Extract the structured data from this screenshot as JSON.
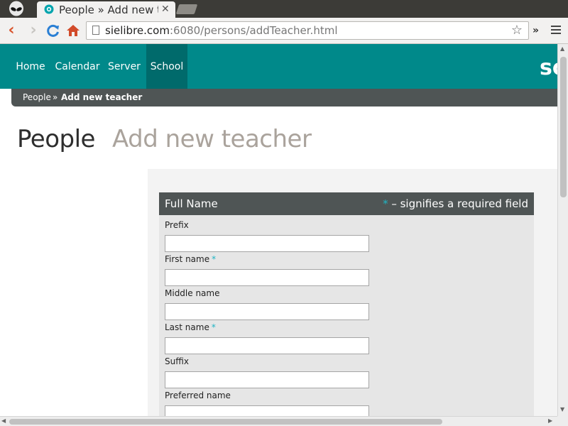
{
  "browser": {
    "tab_title": "People » Add new teacher",
    "tab_close": "✕",
    "url_host": "sielibre.com",
    "url_path": ":6080/persons/addTeacher.html",
    "more_glyph": "»"
  },
  "nav": {
    "items": [
      {
        "label": "Home"
      },
      {
        "label": "Calendar"
      },
      {
        "label": "Server"
      },
      {
        "label": "School"
      }
    ],
    "active": "School",
    "logo_text": "sc"
  },
  "breadcrumb": {
    "items": [
      "People",
      "Add new teacher"
    ],
    "separator": "»"
  },
  "page": {
    "title": "People",
    "subtitle": "Add new teacher"
  },
  "form": {
    "section_title": "Full Name",
    "required_marker": "*",
    "required_note": "– signifies a required field",
    "fields": [
      {
        "label": "Prefix",
        "required": false,
        "value": ""
      },
      {
        "label": "First name",
        "required": true,
        "value": ""
      },
      {
        "label": "Middle name",
        "required": false,
        "value": ""
      },
      {
        "label": "Last name",
        "required": true,
        "value": ""
      },
      {
        "label": "Suffix",
        "required": false,
        "value": ""
      },
      {
        "label": "Preferred name",
        "required": false,
        "value": ""
      }
    ]
  },
  "colors": {
    "navbar": "#00898a",
    "navbar_active": "#006a6b",
    "header_dark": "#4f5555",
    "required_accent": "#1fb4c4",
    "subtitle": "#aaa39c"
  },
  "icons": [
    "alien-logo-icon",
    "tab-favicon-icon",
    "back-arrow-icon",
    "forward-arrow-icon",
    "reload-icon",
    "home-icon",
    "page-icon",
    "bookmark-star-icon",
    "menu-icon"
  ]
}
